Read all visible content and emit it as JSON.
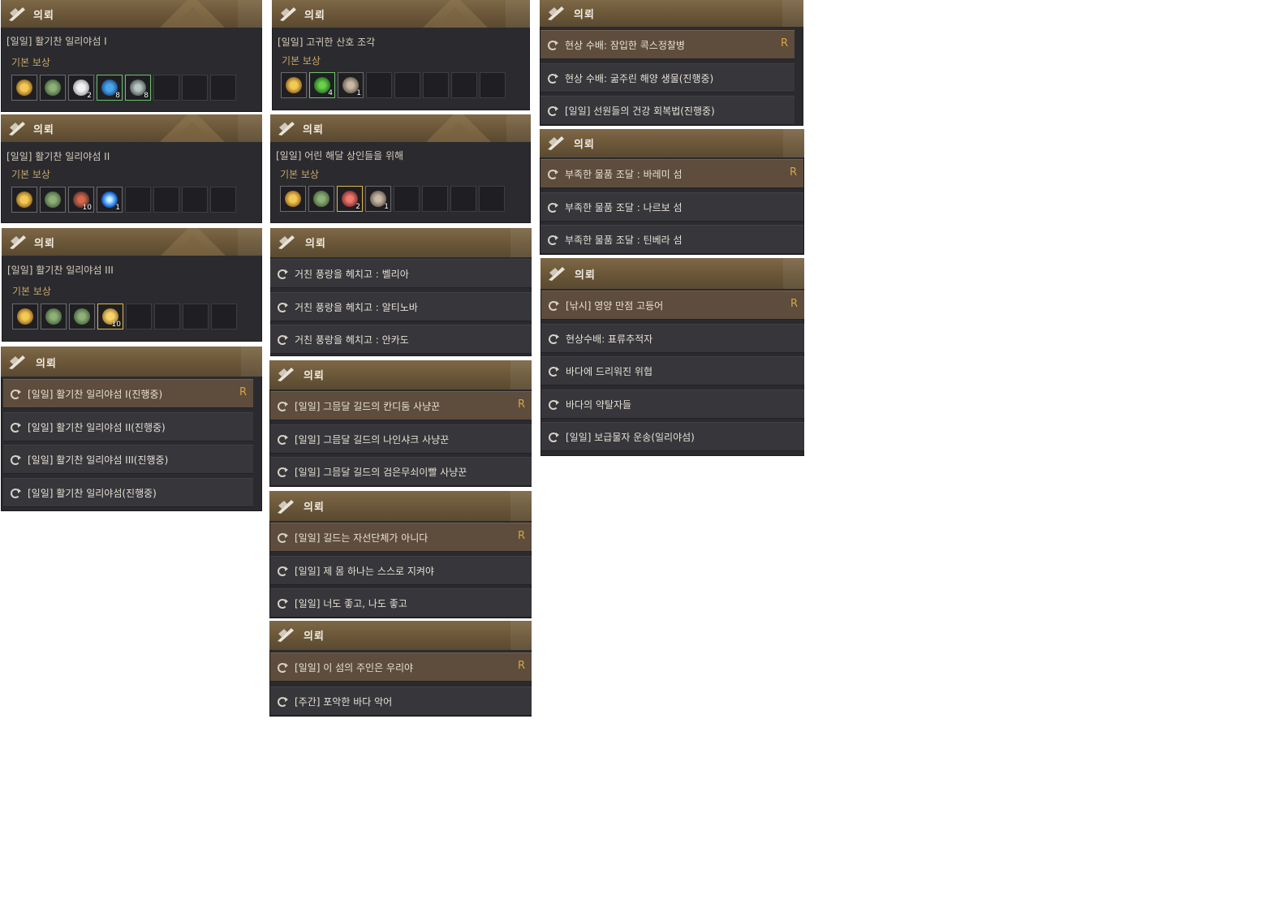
{
  "header_title": "의뢰",
  "reward_label": "기본 보상",
  "badge_r": "R",
  "colors": {
    "header": "#6a5638",
    "panel": "#2b2b2f",
    "row": "#36363b",
    "row_selected": "#5e4d3c",
    "accent": "#d6a344"
  },
  "reward_panels": [
    {
      "quest": "[일일] 활기찬 일리야섬 I",
      "items": [
        {
          "icon": "medal-icon",
          "count": ""
        },
        {
          "icon": "green-scroll-icon",
          "count": ""
        },
        {
          "icon": "silver-ingot-icon",
          "count": "2"
        },
        {
          "icon": "blue-potion-icon",
          "count": "8",
          "rare": true
        },
        {
          "icon": "ore-icon",
          "count": "8",
          "rare": true
        }
      ]
    },
    {
      "quest": "[일일] 고귀한 산호 조각",
      "items": [
        {
          "icon": "medal-icon",
          "count": ""
        },
        {
          "icon": "seaweed-icon",
          "count": "4",
          "rare": true
        },
        {
          "icon": "shell-icon",
          "count": "1"
        }
      ]
    },
    {
      "quest": "[일일] 활기찬 일리야섬 II",
      "items": [
        {
          "icon": "medal-icon",
          "count": ""
        },
        {
          "icon": "green-scroll-icon",
          "count": ""
        },
        {
          "icon": "coral-ore-icon",
          "count": "10"
        },
        {
          "icon": "blue-crystal-icon",
          "count": "1"
        }
      ]
    },
    {
      "quest": "[일일] 어린 해달 상인들을 위해",
      "items": [
        {
          "icon": "medal-icon",
          "count": ""
        },
        {
          "icon": "green-scroll-icon",
          "count": ""
        },
        {
          "icon": "red-coral-icon",
          "count": "2",
          "gold": true
        },
        {
          "icon": "shell-icon",
          "count": "1"
        }
      ]
    },
    {
      "quest": "[일일] 활기찬 일리야섬 III",
      "items": [
        {
          "icon": "medal-icon",
          "count": ""
        },
        {
          "icon": "green-scroll-icon",
          "count": ""
        },
        {
          "icon": "green-scroll-icon",
          "count": ""
        },
        {
          "icon": "gold-coin-icon",
          "count": "10",
          "gold": true
        }
      ]
    }
  ],
  "list_panels": [
    {
      "rows": [
        "[일일] 활기찬 일리야섬 I(진행중)",
        "[일일] 활기찬 일리야섬 II(진행중)",
        "[일일] 활기찬 일리야섬 III(진행중)",
        "[일일] 활기찬 일리야섬(진행중)"
      ]
    },
    {
      "rows": [
        "거친 풍랑을 헤치고 : 벨리아",
        "거친 풍랑을 헤치고 : 알티노바",
        "거친 풍랑을 헤치고 : 안카도"
      ]
    },
    {
      "rows": [
        "[일일] 그믐달 길드의 칸디둠 사냥꾼",
        "[일일] 그믐달 길드의 나인샤크 사냥꾼",
        "[일일] 그믐달 길드의 검은무쇠이빨 사냥꾼"
      ]
    },
    {
      "rows": [
        "[일일] 길드는 자선단체가 아니다",
        "[일일] 제 몸 하나는 스스로 지켜야",
        "[일일] 너도 좋고, 나도 좋고"
      ]
    },
    {
      "rows": [
        "[일일] 이 섬의 주인은 우리야",
        "[주간] 포악한 바다 악어"
      ]
    },
    {
      "rows": [
        "현상 수배: 잠입한 콕스정찰병",
        "현상 수배: 굶주린 해양 생물(진행중)",
        "[일일] 선원들의 건강 회복법(진행중)"
      ]
    },
    {
      "rows": [
        "부족한 물품 조달 : 바레미 섬",
        "부족한 물품 조달 : 나르보 섬",
        "부족한 물품 조달 : 틴베라 섬"
      ]
    },
    {
      "rows": [
        "[낚시] 영양 만점 고등어",
        "현상수배: 표류추적자",
        "바다에 드리워진 위협",
        "바다의 약탈자들",
        "[일일] 보급물자 운송(일리야섬)"
      ]
    }
  ]
}
